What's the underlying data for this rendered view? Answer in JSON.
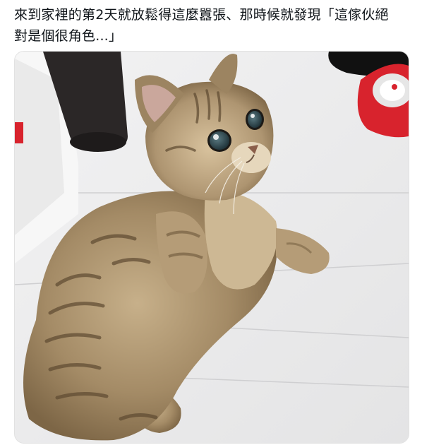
{
  "post": {
    "text_line1": "來到家裡的第2天就放鬆得這麼囂張、那時候就發現「這傢伙絕",
    "text_line2": "對是個很角色...」"
  },
  "photo": {
    "subject": "kitten-photo"
  },
  "colors": {
    "text": "#0f1419",
    "floor": "#ececec",
    "toy_red": "#d8232d",
    "fur": "#a8916f"
  }
}
